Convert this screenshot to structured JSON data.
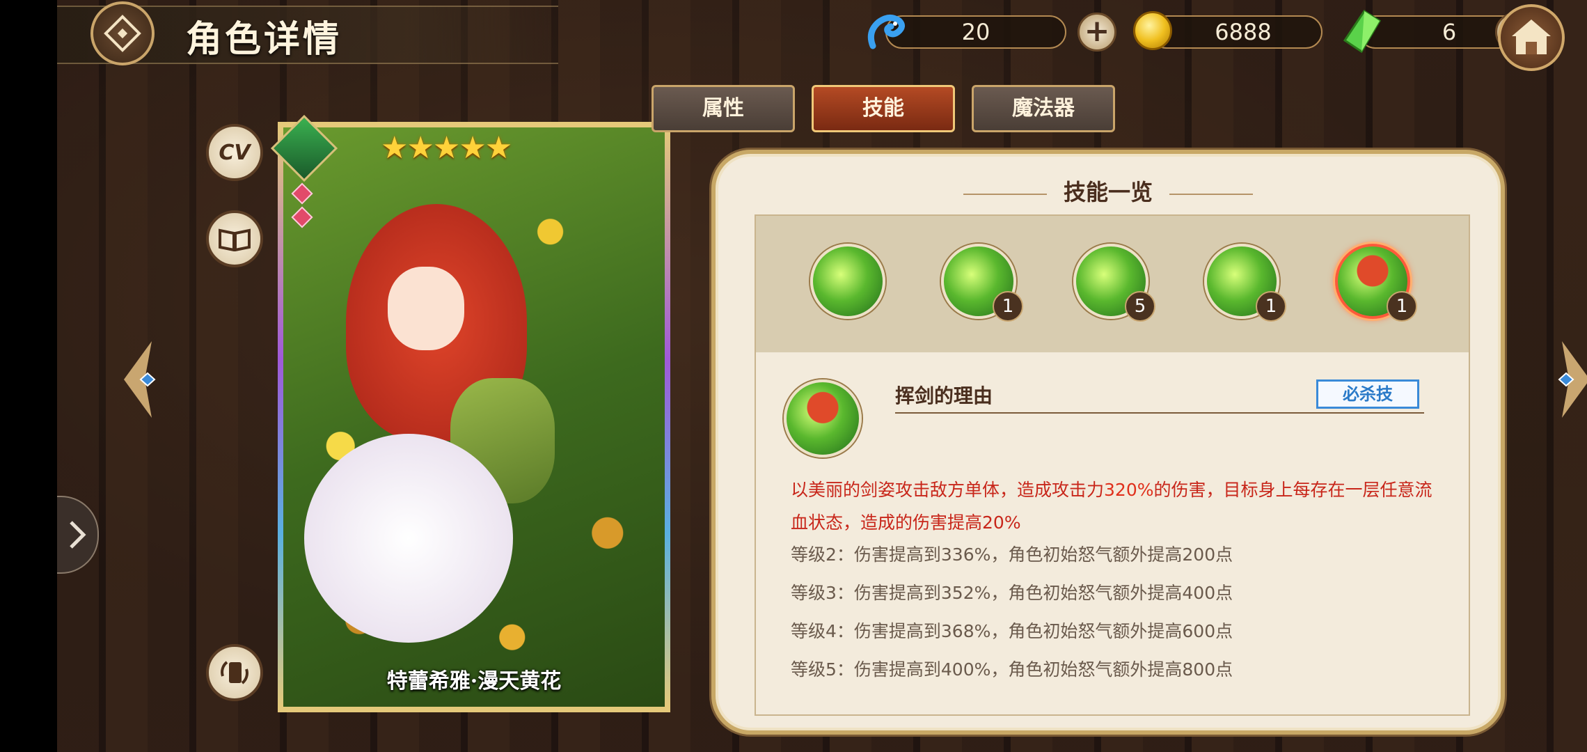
{
  "header": {
    "title": "角色详情"
  },
  "resources": [
    {
      "icon": "blue-dragon-icon",
      "value": "20",
      "has_plus": true
    },
    {
      "icon": "gold-coin-icon",
      "value": "6888",
      "has_plus": false
    },
    {
      "icon": "green-crystal-icon",
      "value": "6",
      "has_plus": true
    }
  ],
  "side_buttons": {
    "cv_label": "CV"
  },
  "card": {
    "name": "特蕾希雅·漫天黄花",
    "stars": 5
  },
  "tabs": [
    {
      "label": "属性",
      "active": false
    },
    {
      "label": "技能",
      "active": true
    },
    {
      "label": "魔法器",
      "active": false
    }
  ],
  "panel": {
    "title": "技能一览",
    "skills": [
      {
        "icon": "sword-light-skill-icon",
        "level": ""
      },
      {
        "icon": "star-burst-skill-icon",
        "level": "1"
      },
      {
        "icon": "green-beam-skill-icon",
        "level": "5"
      },
      {
        "icon": "blade-slash-skill-icon",
        "level": "1"
      },
      {
        "icon": "portrait-sword-skill-icon",
        "level": "1",
        "selected": true
      }
    ],
    "selected_skill": {
      "name": "挥剑的理由",
      "tag": "必杀技",
      "desc_pre": "以美丽的剑姿攻击敌方单体，造成攻击力",
      "desc_hl": "320%",
      "desc_post": "的伤害，目标身上每存在一层任意流血状态，造成的伤害提高20%",
      "levels": [
        "等级2：伤害提高到336%，角色初始怒气额外提高200点",
        "等级3：伤害提高到352%，角色初始怒气额外提高400点",
        "等级4：伤害提高到368%，角色初始怒气额外提高600点",
        "等级5：伤害提高到400%，角色初始怒气额外提高800点"
      ]
    }
  }
}
